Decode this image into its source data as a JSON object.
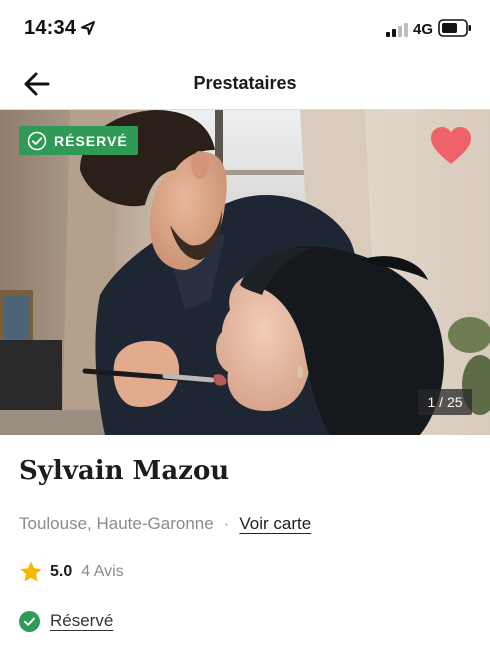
{
  "status_bar": {
    "time": "14:34",
    "network": "4G",
    "icons": [
      "location-arrow-icon",
      "signal-icon",
      "battery-icon"
    ]
  },
  "nav": {
    "title": "Prestataires",
    "back_icon": "back-arrow-icon"
  },
  "hero": {
    "badge_label": "RÉSERVÉ",
    "badge_color": "#2f9a55",
    "favorite_icon": "heart-icon",
    "favorite_color": "#f0626a",
    "photo_counter": "1 / 25"
  },
  "vendor": {
    "name": "Sylvain Mazou",
    "location": "Toulouse, Haute-Garonne",
    "separator": "·",
    "map_link": "Voir carte",
    "rating": "5.0",
    "reviews": "4 Avis",
    "star_color": "#f5b700",
    "status_label": "Réservé",
    "status_color": "#2f9a55"
  }
}
